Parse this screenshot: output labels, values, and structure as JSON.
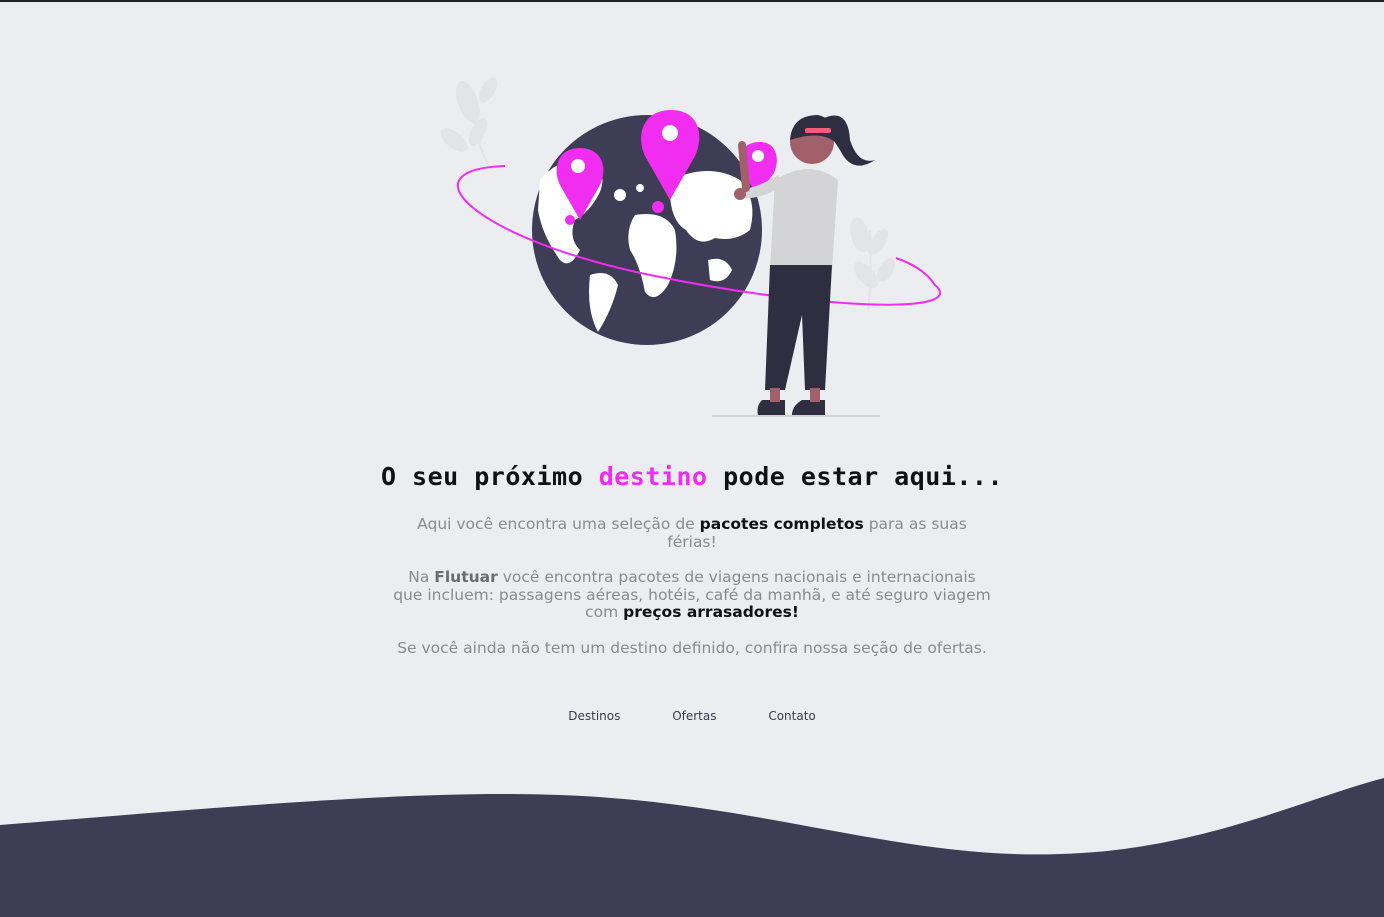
{
  "colors": {
    "background": "#ebedf0",
    "accent": "#f02df0",
    "dark": "#3f3d56",
    "text_muted": "#8a8a8f",
    "text_strong": "#111114"
  },
  "hero": {
    "illustration_icon": "woman-holding-globe-with-map-pins-illustration",
    "headline_before": "O seu próximo",
    "headline_accent": "destino",
    "headline_after": "pode estar aqui..."
  },
  "intro": {
    "p1_before": "Aqui você encontra uma seleção de",
    "p1_strong": "pacotes completos",
    "p1_after": "para as suas férias!",
    "p2_before": "Na",
    "p2_brand": "Flutuar",
    "p2_middle": "você encontra pacotes de viagens nacionais e internacionais que incluem: passagens aéreas, hotéis, café da manhã, e até seguro viagem com",
    "p2_strong": "preços arrasadores!",
    "p3": "Se você ainda não tem um destino definido, confira nossa seção de ofertas."
  },
  "nav": {
    "items": [
      {
        "label": "Destinos"
      },
      {
        "label": "Ofertas"
      },
      {
        "label": "Contato"
      }
    ]
  }
}
